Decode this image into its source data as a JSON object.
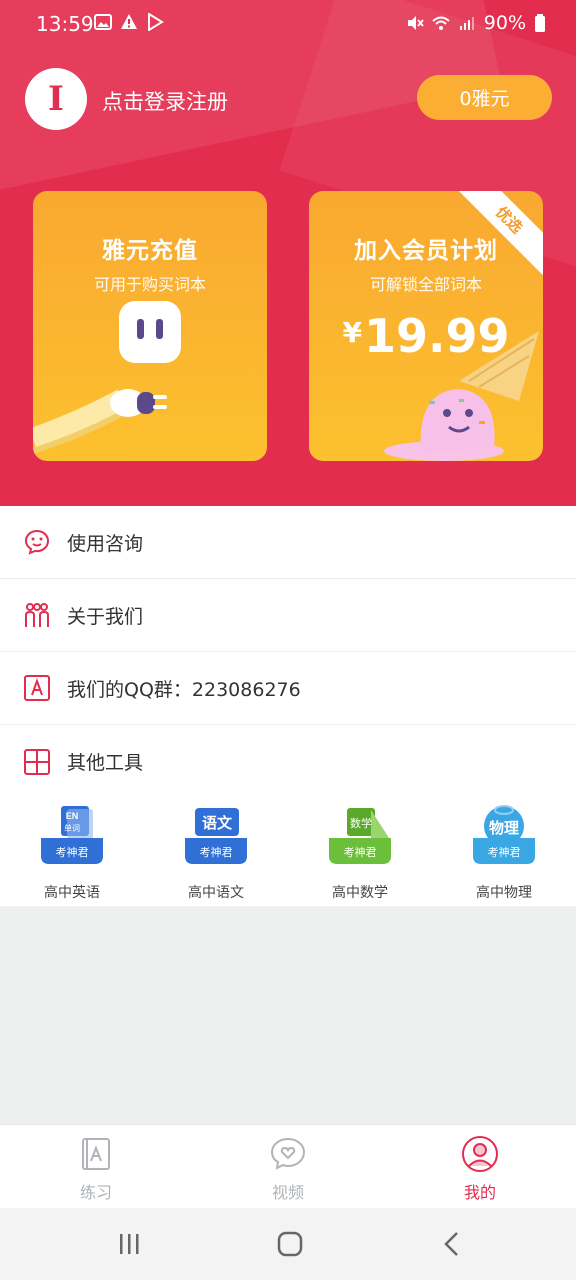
{
  "status_bar": {
    "time": "13:59",
    "battery": "90%"
  },
  "profile": {
    "avatar_letter": "I",
    "login_text": "点击登录注册",
    "coins_label": "0雅元"
  },
  "cards": {
    "recharge": {
      "title": "雅元充值",
      "subtitle": "可用于购买词本"
    },
    "membership": {
      "title": "加入会员计划",
      "subtitle": "可解锁全部词本",
      "currency": "¥",
      "price": "19.99",
      "badge": "优选"
    }
  },
  "menu": {
    "consult": "使用咨询",
    "about": "关于我们",
    "qq_group": "我们的QQ群：223086276",
    "other_tools": "其他工具"
  },
  "tools": [
    {
      "name": "高中英语",
      "logo_top": "EN",
      "logo_sub": "单词",
      "logo_bottom": "考神君",
      "color": "#3b7be0"
    },
    {
      "name": "高中语文",
      "logo_top": "语文",
      "logo_sub": "",
      "logo_bottom": "考神君",
      "color": "#2f6fd6"
    },
    {
      "name": "高中数学",
      "logo_top": "数学",
      "logo_sub": "",
      "logo_bottom": "考神君",
      "color": "#6cbf3a"
    },
    {
      "name": "高中物理",
      "logo_top": "物理",
      "logo_sub": "",
      "logo_bottom": "考神君",
      "color": "#3aa6e4"
    }
  ],
  "tabs": {
    "practice": "练习",
    "video": "视频",
    "mine": "我的"
  },
  "colors": {
    "brand_red": "#e32d4e",
    "card_orange": "#f9a830",
    "coin_button": "#fbae33"
  }
}
